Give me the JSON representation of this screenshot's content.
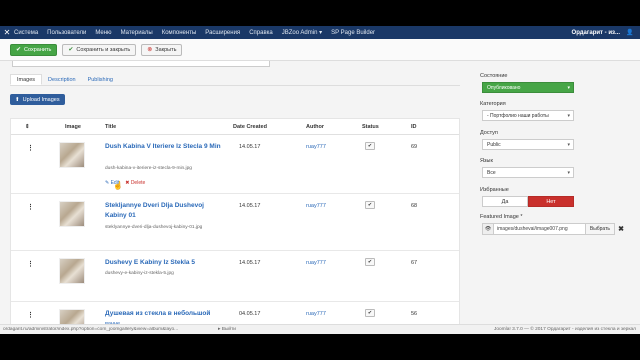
{
  "topnav": {
    "items": [
      "Система",
      "Пользователи",
      "Меню",
      "Материалы",
      "Компоненты",
      "Расширения",
      "Справка",
      "JBZoo Admin ▾",
      "SP Page Builder"
    ],
    "site": "Ордагарит - из...",
    "accent": "#1a3867"
  },
  "toolbar": {
    "save": "Сохранить",
    "save_close": "Сохранить и закрыть",
    "close": "Закрыть"
  },
  "tabs": [
    "Images",
    "Description",
    "Publishing"
  ],
  "upload_label": "Upload Images",
  "table": {
    "columns": [
      "Image",
      "Title",
      "Date Created",
      "Author",
      "Status",
      "ID"
    ],
    "rows": [
      {
        "title": "Dush Kabina V Iteriere Iz Stecla 9 Min",
        "file": "dush-kabina-v-iteriere-iz-stecla-9-min.jpg",
        "date": "14.05.17",
        "author": "ruay777",
        "id": "69",
        "edit": "Edit",
        "delete": "Delete"
      },
      {
        "title": "Stekljannye Dveri Dlja Dushevoj Kabiny 01",
        "file": "steklyannye-dveri-dlja-dushevoj-kabiny-01.jpg",
        "date": "14.05.17",
        "author": "ruay777",
        "id": "68"
      },
      {
        "title": "Dushevy E Kabiny Iz Stekla 5",
        "file": "dushevy-e-kabiny-iz-stekla-5.jpg",
        "date": "14.05.17",
        "author": "ruay777",
        "id": "67"
      },
      {
        "title": "Душевая из стекла в небольшой",
        "file": "ванне",
        "date": "04.05.17",
        "author": "ruay777",
        "id": "56"
      }
    ]
  },
  "side": {
    "state_label": "Состояние",
    "state_value": "Опубликовано",
    "category_label": "Категория",
    "category_value": "- Портфолио наши работы",
    "access_label": "Доступ",
    "access_value": "Public",
    "lang_label": "Язык",
    "lang_value": "Все",
    "featured_label": "Избранные",
    "featured_yes": "Да",
    "featured_no": "Нет",
    "image_label": "Featured Image *",
    "image_path": "images/dushevai/image007.png",
    "browse": "Выбрать",
    "clear": "✖"
  },
  "footer": {
    "url": "ordagarit.ru/administrator/index.php?option=com_joomgallery&view=album&layo...",
    "exit": "▸ Выйти",
    "copy": "Joomla! 3.7.0 — © 2017 Ордагарит - изделия из стекла и зеркал"
  }
}
